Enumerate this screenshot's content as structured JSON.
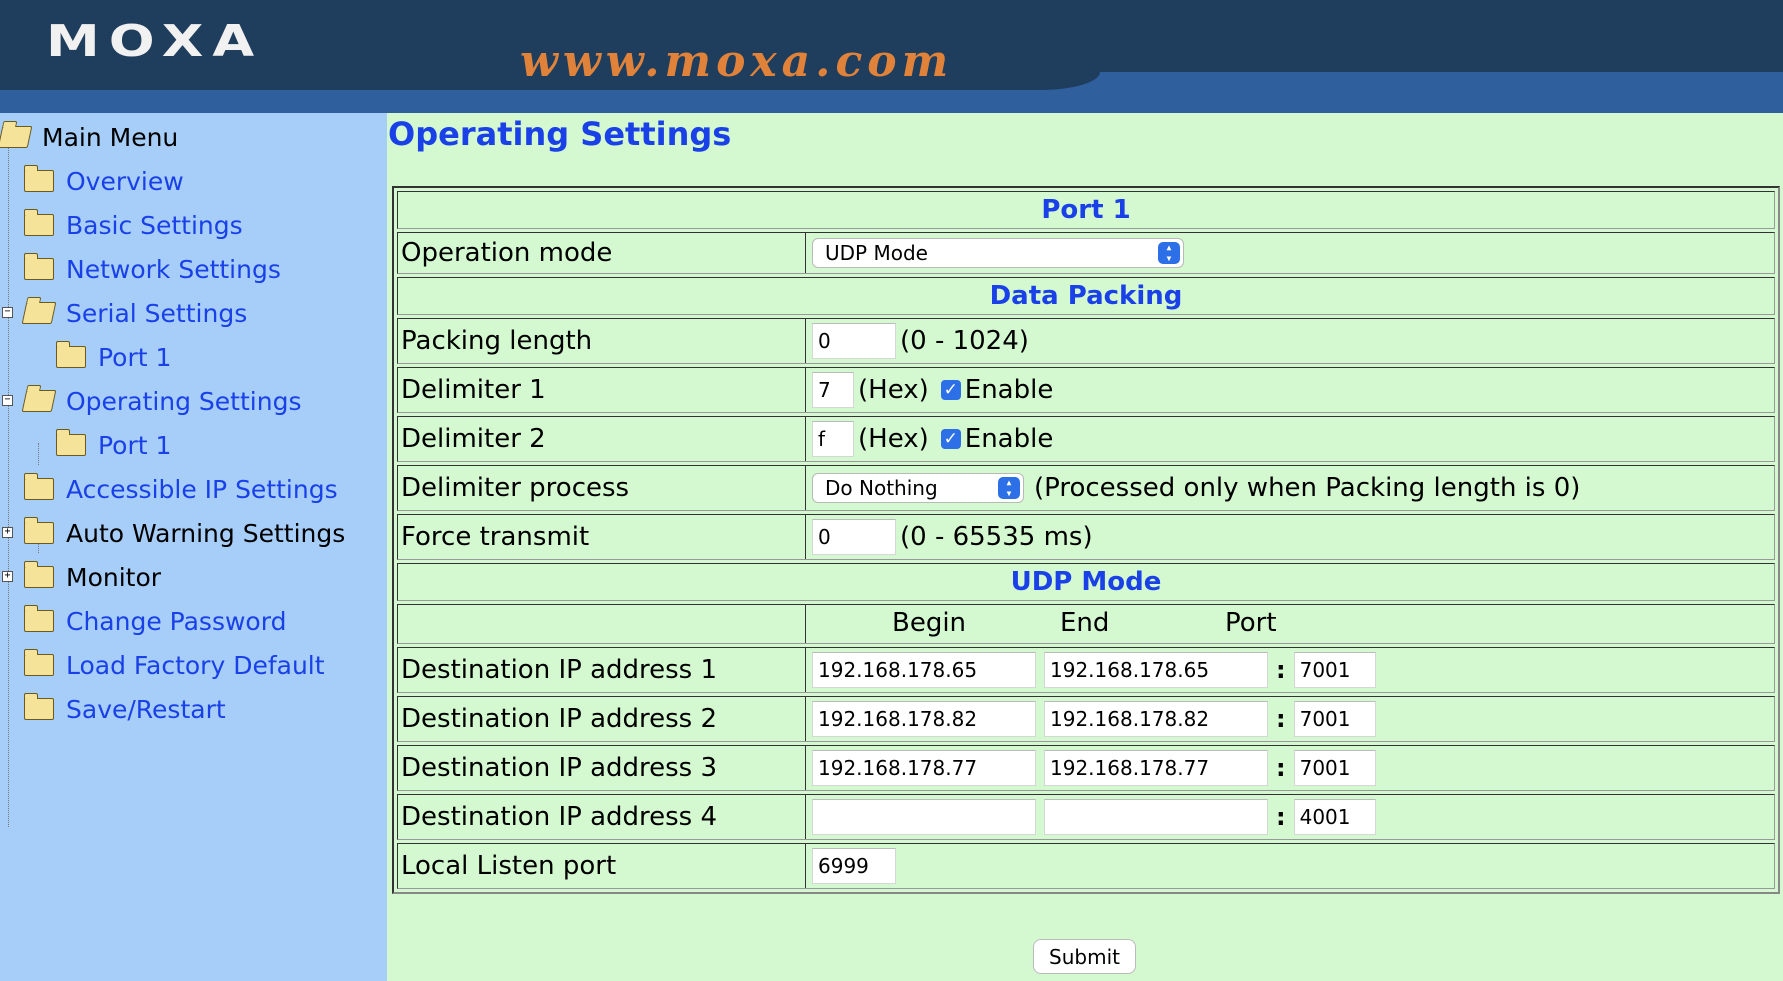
{
  "header": {
    "logo": "MOXA",
    "url": "www.moxa.com"
  },
  "sidebar": {
    "root": "Main Menu",
    "items": [
      {
        "label": "Overview"
      },
      {
        "label": "Basic Settings"
      },
      {
        "label": "Network Settings"
      },
      {
        "label": "Serial Settings",
        "expander": "−"
      },
      {
        "label": "Port 1"
      },
      {
        "label": "Operating Settings",
        "expander": "−"
      },
      {
        "label": "Port 1"
      },
      {
        "label": "Accessible IP Settings"
      },
      {
        "label": "Auto Warning Settings",
        "expander": "+"
      },
      {
        "label": "Monitor",
        "expander": "+"
      },
      {
        "label": "Change Password"
      },
      {
        "label": "Load Factory Default"
      },
      {
        "label": "Save/Restart"
      }
    ]
  },
  "main": {
    "title": "Operating Settings",
    "sections": {
      "port": "Port 1",
      "packing": "Data Packing",
      "udp": "UDP Mode"
    },
    "operation_mode": {
      "label": "Operation mode",
      "value": "UDP Mode"
    },
    "packing_length": {
      "label": "Packing length",
      "value": "0",
      "hint": "(0 - 1024)"
    },
    "delimiter1": {
      "label": "Delimiter 1",
      "value": "7",
      "hex": "(Hex)",
      "enable": "Enable",
      "checked": true
    },
    "delimiter2": {
      "label": "Delimiter 2",
      "value": "f",
      "hex": "(Hex)",
      "enable": "Enable",
      "checked": true
    },
    "delimiter_process": {
      "label": "Delimiter process",
      "value": "Do Nothing",
      "hint": "(Processed only when Packing length is 0)"
    },
    "force_transmit": {
      "label": "Force transmit",
      "value": "0",
      "hint": "(0 - 65535 ms)"
    },
    "udp_headers": {
      "begin": "Begin",
      "end": "End",
      "port": "Port"
    },
    "destinations": [
      {
        "label": "Destination IP address 1",
        "begin": "192.168.178.65",
        "end": "192.168.178.65",
        "port": "7001"
      },
      {
        "label": "Destination IP address 2",
        "begin": "192.168.178.82",
        "end": "192.168.178.82",
        "port": "7001"
      },
      {
        "label": "Destination IP address 3",
        "begin": "192.168.178.77",
        "end": "192.168.178.77",
        "port": "7001"
      },
      {
        "label": "Destination IP address 4",
        "begin": "",
        "end": "",
        "port": "4001"
      }
    ],
    "local_listen": {
      "label": "Local Listen port",
      "value": "6999"
    },
    "colon": ":",
    "submit": "Submit"
  }
}
